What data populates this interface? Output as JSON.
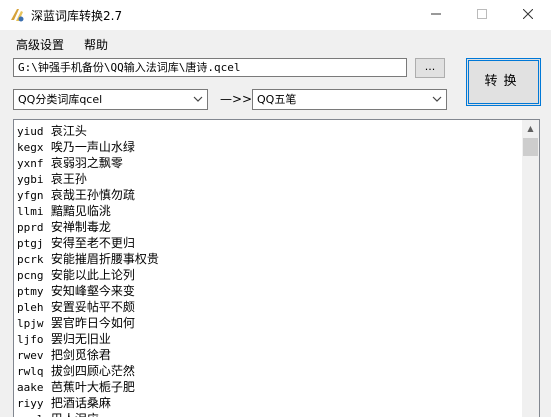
{
  "window": {
    "title": "深蓝词库转换2.7"
  },
  "menu": [
    "高级设置",
    "帮助"
  ],
  "file_path": "G:\\钟强手机备份\\QQ输入法词库\\唐诗.qcel",
  "browse_label": "...",
  "convert_label": "转换",
  "source_format": "QQ分类词库qcel",
  "arrow_label": "—>>",
  "target_format": "QQ五笔",
  "entries": [
    {
      "code": "yiud",
      "word": "哀江头"
    },
    {
      "code": "kegx",
      "word": "唉乃一声山水绿"
    },
    {
      "code": "yxnf",
      "word": "哀弱羽之飘零"
    },
    {
      "code": "ygbi",
      "word": "哀王孙"
    },
    {
      "code": "yfgn",
      "word": "哀哉王孙慎勿疏"
    },
    {
      "code": "llmi",
      "word": "黯黯见临洮"
    },
    {
      "code": "pprd",
      "word": "安禅制毒龙"
    },
    {
      "code": "ptgj",
      "word": "安得至老不更归"
    },
    {
      "code": "pcrk",
      "word": "安能摧眉折腰事权贵"
    },
    {
      "code": "pcng",
      "word": "安能以此上论列"
    },
    {
      "code": "ptmy",
      "word": "安知峰壑今来变"
    },
    {
      "code": "pleh",
      "word": "安置妥帖平不颇"
    },
    {
      "code": "lpjw",
      "word": "罢官昨日今如何"
    },
    {
      "code": "ljfo",
      "word": "罢归无旧业"
    },
    {
      "code": "rwev",
      "word": "把剑觅徐君"
    },
    {
      "code": "rwlq",
      "word": "拔剑四顾心茫然"
    },
    {
      "code": "aake",
      "word": "芭蕉叶大栀子肥"
    },
    {
      "code": "riyy",
      "word": "把酒话桑麻"
    },
    {
      "code": "rwyl",
      "word": "巴人泪应"
    }
  ],
  "icons": {
    "app": "app-logo-icon",
    "minimize": "minimize-icon",
    "maximize": "maximize-icon",
    "close": "close-icon",
    "dropdown": "chevron-down-icon",
    "scroll_up": "scroll-up-arrow-icon"
  }
}
